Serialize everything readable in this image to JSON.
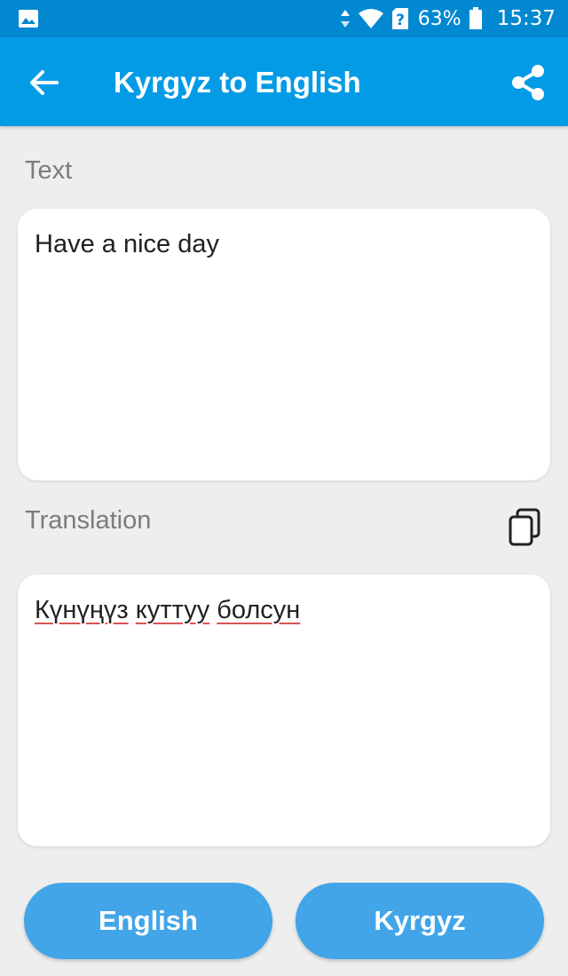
{
  "status_bar": {
    "battery_percent": "63%",
    "time": "15:37",
    "icons": [
      "gallery-icon",
      "data-arrows-icon",
      "wifi-icon",
      "sim-unknown-icon",
      "battery-icon"
    ]
  },
  "app_bar": {
    "title": "Kyrgyz to English",
    "back_icon": "arrow-back-icon",
    "share_icon": "share-icon"
  },
  "input": {
    "label": "Text",
    "value": "Have a nice day"
  },
  "output": {
    "label": "Translation",
    "copy_icon": "copy-icon",
    "words": [
      "Күнүңүз",
      "куттуу",
      "болсун"
    ]
  },
  "buttons": {
    "source": "English",
    "target": "Kyrgyz"
  },
  "colors": {
    "status_bar": "#0288d1",
    "app_bar": "#039be5",
    "button": "#42a5e8",
    "background": "#eeeeee",
    "spellcheck_underline": "#d9534f"
  }
}
